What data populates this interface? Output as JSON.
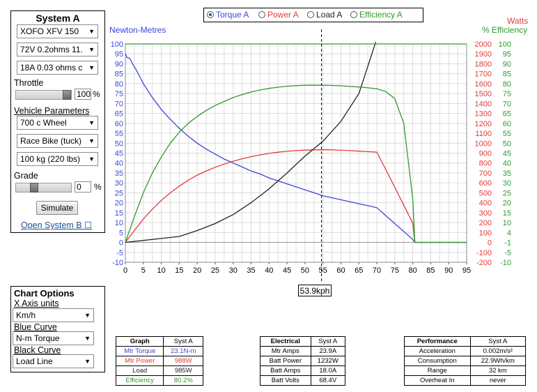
{
  "system": {
    "title": "System A",
    "motor": "XOFO XFV 150",
    "battery": "72V 0.2ohms 11.",
    "controller": "18A 0.03 ohms c",
    "throttle_label": "Throttle",
    "throttle_value": "100",
    "throttle_unit": "%",
    "throttle_level": 1.0,
    "vehicle_label": "Vehicle Parameters",
    "wheel": "700 c  Wheel",
    "position": "Race Bike (tuck)",
    "mass": "100 kg (220 lbs)",
    "grade_label": "Grade",
    "grade_value": "0",
    "grade_unit": "%",
    "grade_level": 0.3,
    "simulate_label": "Simulate",
    "open_system_b": "Open System B ☐"
  },
  "options": {
    "title": "Chart Options",
    "x_axis_label": "X Axis units",
    "x_axis_value": "Km/h",
    "blue_label": "Blue Curve",
    "blue_value": "N-m Torque",
    "black_label": "Black Curve",
    "black_value": "Load Line"
  },
  "legend": {
    "torque": "Torque A",
    "power": "Power A",
    "load": "Load A",
    "efficiency": "Efficiency A"
  },
  "colors": {
    "torque": "#3a46d8",
    "power": "#e23b3b",
    "load": "#222222",
    "efficiency": "#2e9a2e",
    "left_axis_text": "#3a46d8",
    "right_power_text": "#e23b3b",
    "right_eff_text": "#2e9a2e"
  },
  "speed_readout": "53.9kph",
  "chart_data": {
    "type": "line",
    "xlabel": "",
    "ylabel_left": "Newton-Metres",
    "ylabel_right_power": "Watts",
    "ylabel_right_eff": "% Efficiency",
    "xlim": [
      0,
      95
    ],
    "ylim": [
      -10,
      100
    ],
    "y_power_lim": [
      -200,
      2000
    ],
    "x_ticks": [
      "0",
      "5",
      "10",
      "15",
      "20",
      "25",
      "30",
      "35",
      "40",
      "45",
      "50",
      "55",
      "60",
      "65",
      "70",
      "75",
      "80",
      "85",
      "90",
      "95"
    ],
    "y_ticks": [
      "100",
      "95",
      "90",
      "85",
      "80",
      "75",
      "70",
      "65",
      "60",
      "55",
      "50",
      "45",
      "40",
      "35",
      "30",
      "25",
      "20",
      "15",
      "10",
      "5",
      "0",
      "-5",
      "-10"
    ],
    "power_ticks": [
      "2000",
      "1900",
      "1800",
      "1700",
      "1600",
      "1500",
      "1400",
      "1300",
      "1200",
      "1100",
      "1000",
      "900",
      "800",
      "700",
      "600",
      "500",
      "400",
      "300",
      "200",
      "100",
      "0",
      "-100",
      "-200"
    ],
    "eff_ticks": [
      "100",
      "95",
      "90",
      "85",
      "80",
      "75",
      "70",
      "65",
      "60",
      "55",
      "50",
      "45",
      "40",
      "35",
      "30",
      "25",
      "20",
      "15",
      "10",
      "4",
      "-1",
      "-5",
      "-10"
    ],
    "marker_x": 54.6,
    "series": [
      {
        "name": "Torque A",
        "x": [
          0,
          0.5,
          1,
          1.5,
          2,
          3,
          5,
          7.5,
          10,
          12.5,
          15,
          17.5,
          20,
          22.5,
          25,
          27.5,
          30,
          32.5,
          35,
          37.5,
          40,
          42.5,
          45,
          47.5,
          50,
          52.5,
          55,
          57.5,
          60,
          62.5,
          65,
          67.5,
          70,
          72.5,
          75,
          77.5,
          80,
          80.6,
          85,
          90,
          95
        ],
        "y": [
          95,
          93,
          93,
          92,
          90,
          87,
          80,
          73,
          67,
          62,
          57.5,
          53.5,
          50,
          47,
          44.5,
          42,
          40,
          38,
          36,
          34.5,
          32.5,
          31,
          29.5,
          28,
          26.5,
          25,
          23.5,
          22.5,
          21.5,
          20.5,
          19.5,
          18.5,
          17.5,
          13.5,
          9.5,
          5.5,
          1.5,
          0,
          0,
          0,
          0
        ]
      },
      {
        "name": "Power A",
        "x": [
          0,
          2.5,
          5,
          7.5,
          10,
          12.5,
          15,
          17.5,
          20,
          22.5,
          25,
          27.5,
          30,
          32.5,
          35,
          37.5,
          40,
          42.5,
          45,
          47.5,
          50,
          52.5,
          55,
          57.5,
          60,
          62.5,
          65,
          67.5,
          70,
          72.5,
          75,
          77.5,
          80,
          80.6,
          85,
          90,
          95
        ],
        "y": [
          0,
          120,
          235,
          335,
          423,
          500,
          567,
          627,
          678,
          720,
          757,
          789,
          817,
          843,
          864,
          882,
          897,
          909,
          918,
          925,
          930,
          933,
          934,
          932,
          929,
          925,
          920,
          915,
          910,
          735,
          555,
          375,
          195,
          0,
          0,
          0,
          0
        ]
      },
      {
        "name": "Load A",
        "x": [
          0,
          5,
          10,
          15,
          20,
          25,
          30,
          35,
          40,
          45,
          50,
          55,
          60,
          65,
          69.7
        ],
        "y": [
          0,
          1,
          2,
          3,
          6,
          9.5,
          14,
          20,
          27,
          35,
          43.5,
          51,
          61,
          75,
          101
        ]
      },
      {
        "name": "Efficiency A",
        "x": [
          0,
          2.5,
          5,
          7.5,
          10,
          12.5,
          15,
          17.5,
          20,
          22.5,
          25,
          27.5,
          30,
          32.5,
          35,
          37.5,
          40,
          42.5,
          45,
          47.5,
          50,
          52.5,
          55,
          57.5,
          60,
          62.5,
          65,
          67.5,
          70,
          72.5,
          75,
          77.5,
          80,
          80.6,
          85,
          90,
          95
        ],
        "y": [
          0,
          13,
          25,
          35,
          43,
          50,
          55.5,
          60,
          63.5,
          66.5,
          69,
          71,
          73,
          74.5,
          75.8,
          76.8,
          77.6,
          78.2,
          78.7,
          79,
          79.2,
          79.2,
          79.2,
          79.1,
          78.9,
          78.6,
          78.3,
          77.9,
          77.4,
          76,
          72.5,
          60,
          22,
          0,
          0,
          0,
          0
        ]
      },
      {
        "name": "Efficiency ceiling",
        "x": [
          0,
          95
        ],
        "y": [
          100,
          100
        ]
      }
    ]
  },
  "graph_table": {
    "headers": [
      "Graph",
      "Syst A"
    ],
    "rows": [
      {
        "label": "Mtr Torque",
        "value": "23.1N-m",
        "color": "#3a46d8"
      },
      {
        "label": "Mtr Power",
        "value": "988W",
        "color": "#e23b3b"
      },
      {
        "label": "Load",
        "value": "985W",
        "color": "#222222"
      },
      {
        "label": "Efficiency",
        "value": "80.2%",
        "color": "#2e9a2e"
      }
    ]
  },
  "electrical_table": {
    "headers": [
      "Electrical",
      "Syst A"
    ],
    "rows": [
      {
        "label": "Mtr Amps",
        "value": "23.9A"
      },
      {
        "label": "Batt Power",
        "value": "1232W"
      },
      {
        "label": "Batt Amps",
        "value": "18.0A"
      },
      {
        "label": "Batt Volts",
        "value": "68.4V"
      }
    ]
  },
  "performance_table": {
    "headers": [
      "Performance",
      "Syst A"
    ],
    "rows": [
      {
        "label": "Acceleration",
        "value": "0.002m/s²"
      },
      {
        "label": "Consumption",
        "value": "22.9Wh/km"
      },
      {
        "label": "Range",
        "value": "32 km"
      },
      {
        "label": "Overheat In",
        "value": "never"
      }
    ]
  }
}
